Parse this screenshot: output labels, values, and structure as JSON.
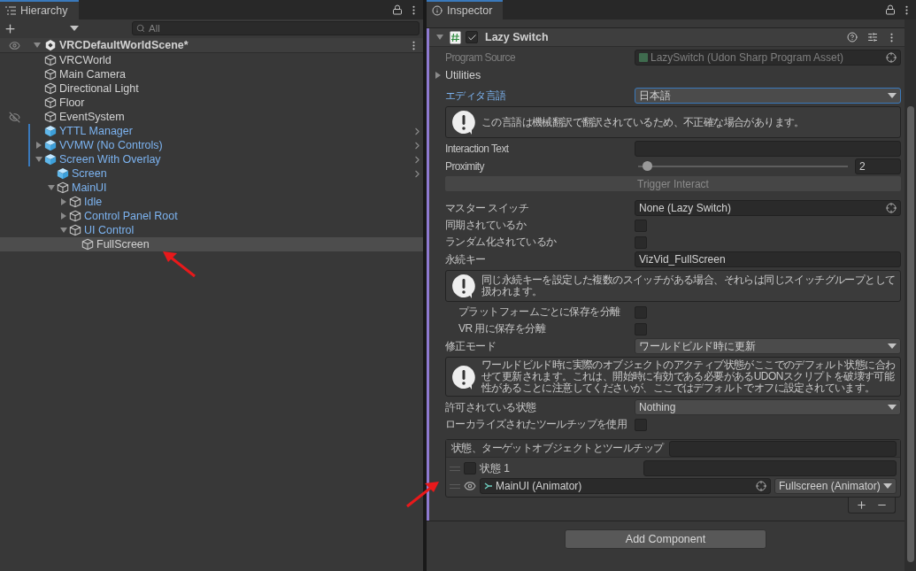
{
  "hierarchy": {
    "tab": "Hierarchy",
    "search": {
      "placeholder": "All"
    },
    "scene": {
      "label": "VRCDefaultWorldScene*",
      "expanded": true,
      "children": [
        {
          "label": "VRCWorld",
          "kind": "object",
          "selected": false,
          "hidden": false,
          "overridden": false
        },
        {
          "label": "Main Camera",
          "kind": "object",
          "selected": false,
          "hidden": false,
          "overridden": false
        },
        {
          "label": "Directional Light",
          "kind": "object",
          "selected": false,
          "hidden": false,
          "overridden": false
        },
        {
          "label": "Floor",
          "kind": "object",
          "selected": false,
          "hidden": false,
          "overridden": false
        },
        {
          "label": "EventSystem",
          "kind": "object",
          "selected": false,
          "hidden": true,
          "overridden": false
        },
        {
          "label": "YTTL Manager",
          "kind": "prefab",
          "selected": false,
          "hidden": false,
          "overridden": true
        },
        {
          "label": "VVMW (No Controls)",
          "kind": "prefab",
          "selected": false,
          "hidden": false,
          "overridden": true,
          "expanded": false
        },
        {
          "label": "Screen With Overlay",
          "kind": "prefab",
          "selected": false,
          "hidden": false,
          "overridden": true,
          "expanded": true,
          "children": [
            {
              "label": "Screen",
              "kind": "prefab",
              "selected": false,
              "hidden": false
            },
            {
              "label": "MainUI",
              "kind": "prefab-child",
              "selected": false,
              "hidden": false,
              "expanded": true,
              "children": [
                {
                  "label": "Idle",
                  "kind": "prefab-child",
                  "selected": false,
                  "hidden": false,
                  "expanded": false
                },
                {
                  "label": "Control Panel Root",
                  "kind": "prefab-child",
                  "selected": false,
                  "hidden": false,
                  "expanded": false
                },
                {
                  "label": "UI Control",
                  "kind": "prefab-child",
                  "selected": false,
                  "hidden": false,
                  "expanded": true,
                  "children": [
                    {
                      "label": "FullScreen",
                      "kind": "object",
                      "selected": true,
                      "hidden": false
                    }
                  ]
                }
              ]
            }
          ]
        }
      ]
    }
  },
  "inspector": {
    "tab": "Inspector",
    "component": {
      "title": "Lazy Switch",
      "enabled": true,
      "expanded": true,
      "fields": [
        {
          "kind": "object",
          "label": "Program Source",
          "value": "LazySwitch (Udon Sharp Program Asset)",
          "disabled": true
        },
        {
          "kind": "foldout",
          "label": "Utilities",
          "expanded": false
        },
        {
          "kind": "dropdown",
          "label": "エディタ言語",
          "value": "日本語",
          "focused": true
        },
        {
          "kind": "help",
          "text": "この言語は機械翻訳で翻訳されているため、不正確な場合があります。"
        },
        {
          "kind": "text",
          "label": "Interaction Text"
        },
        {
          "kind": "slider",
          "label": "Proximity",
          "level": 0.02,
          "value": "2"
        },
        {
          "kind": "button",
          "label": "Trigger Interact"
        },
        {
          "kind": "spacer"
        },
        {
          "kind": "object",
          "label": "マスター スイッチ",
          "value": "None (Lazy Switch)",
          "disabled": false
        },
        {
          "kind": "checkbox",
          "label": "同期されているか",
          "checked": false
        },
        {
          "kind": "checkbox",
          "label": "ランダム化されているか",
          "checked": false
        },
        {
          "kind": "text",
          "label": "永続キー",
          "value": "VizVid_FullScreen"
        },
        {
          "kind": "help",
          "text": "同じ永続キーを設定した複数のスイッチがある場合、それらは同じスイッチグループとして扱われます。"
        },
        {
          "kind": "subcheckbox",
          "label": "プラットフォームごとに保存を分離",
          "checked": false
        },
        {
          "kind": "subcheckbox",
          "label": "VR 用に保存を分離",
          "checked": false
        },
        {
          "kind": "dropdown",
          "label": "修正モード",
          "value": "ワールドビルド時に更新",
          "focused": false
        },
        {
          "kind": "help",
          "text": "ワールドビルド時に実際のオブジェクトのアクティブ状態がここでのデフォルト状態に合わせて更新されます。これは、開始時に有効である必要があるUDONスクリプトを破壊す可能性があることに注意してくださいが、ここではデフォルトでオフに設定されています。"
        },
        {
          "kind": "dropdown",
          "label": "許可されている状態",
          "value": "Nothing",
          "focused": false
        },
        {
          "kind": "checkbox",
          "label": "ローカライズされたツールチップを使用",
          "checked": false
        },
        {
          "kind": "list",
          "label": "状態、ターゲットオブジェクトとツールチップ",
          "items": [
            {
              "label": "状態 1",
              "checked": false,
              "targets": [
                {
                  "visible": true,
                  "object": "MainUI (Animator)",
                  "property": "Fullscreen (Animator)"
                }
              ]
            }
          ]
        }
      ]
    },
    "add_button": "Add Component"
  }
}
